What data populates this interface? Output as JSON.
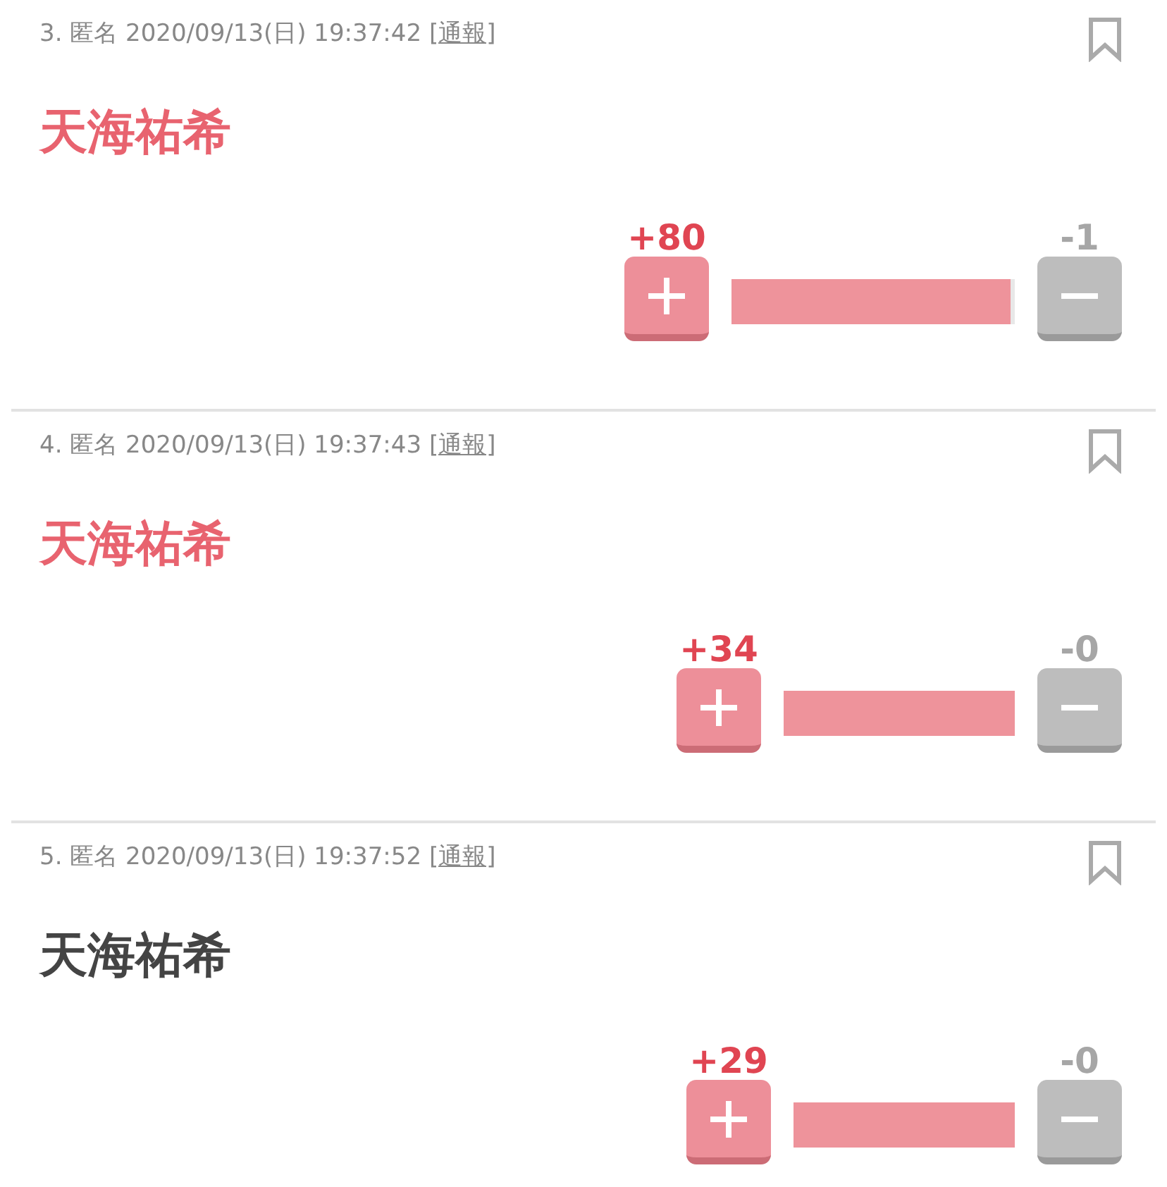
{
  "posts": [
    {
      "meta": "3. 匿名 2020/09/13(日) 19:37:42",
      "report_link": "[通報]",
      "title": "天海祐希",
      "color": "#e8636f",
      "plus_count": "+80",
      "minus_count": "-1",
      "level": 0.985
    },
    {
      "meta": "4. 匿名 2020/09/13(日) 19:37:43",
      "report_link": "[通報]",
      "title": "天海祐希",
      "color": "#e8636f",
      "plus_count": "+34",
      "minus_count": "-0",
      "level": 1
    },
    {
      "meta": "5. 匿名 2020/09/13(日) 19:37:52",
      "report_link": "[通報]",
      "title": "天海祐希",
      "color": "#444444",
      "plus_count": "+29",
      "minus_count": "-0",
      "level": 1
    }
  ]
}
